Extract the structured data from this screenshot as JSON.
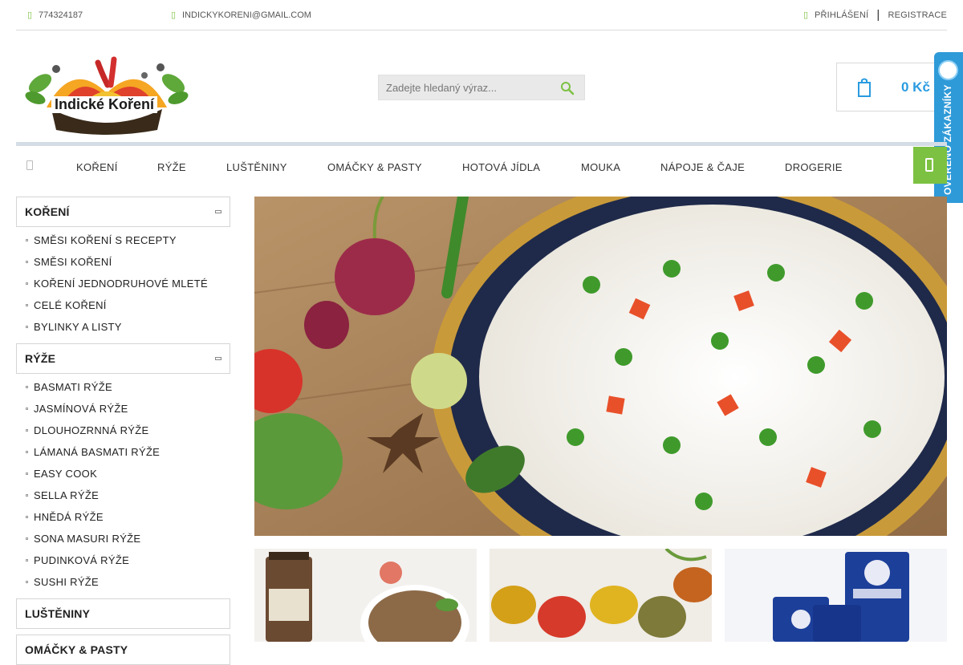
{
  "topbar": {
    "phone": "774324187",
    "email": "INDICKYKORENI@GMAIL.COM",
    "login": "PŘIHLÁŠENÍ",
    "separator": "|",
    "register": "REGISTRACE"
  },
  "header": {
    "logo_text": "Indické Koření",
    "search_placeholder": "Zadejte hledaný výraz...",
    "cart_total": "0 Kč",
    "verified_label": "OVĚŘENO ZÁKAZNÍKY"
  },
  "nav": {
    "items": [
      "KOŘENÍ",
      "RÝŽE",
      "LUŠTĚNINY",
      "OMÁČKY & PASTY",
      "HOTOVÁ JÍDLA",
      "MOUKA",
      "NÁPOJE & ČAJE",
      "DROGERIE"
    ]
  },
  "sidebar": {
    "categories": [
      {
        "title": "KOŘENÍ",
        "items": [
          "SMĚSI KOŘENÍ S RECEPTY",
          "SMĚSI KOŘENÍ",
          "KOŘENÍ JEDNODRUHOVÉ MLETÉ",
          "CELÉ KOŘENÍ",
          "BYLINKY A LISTY"
        ]
      },
      {
        "title": "RÝŽE",
        "items": [
          "BASMATI RÝŽE",
          "JASMÍNOVÁ RÝŽE",
          "DLOUHOZRNNÁ RÝŽE",
          "LÁMANÁ BASMATI RÝŽE",
          "EASY COOK",
          "SELLA RÝŽE",
          "HNĚDÁ RÝŽE",
          "SONA MASURI RÝŽE",
          "PUDINKOVÁ RÝŽE",
          "SUSHI RÝŽE"
        ]
      },
      {
        "title": "LUŠTĚNINY",
        "items": []
      },
      {
        "title": "OMÁČKY & PASTY",
        "items": []
      }
    ]
  },
  "colors": {
    "accent_green": "#7cc142",
    "accent_blue": "#2a9be0",
    "verified_blue": "#2f9ad8"
  }
}
